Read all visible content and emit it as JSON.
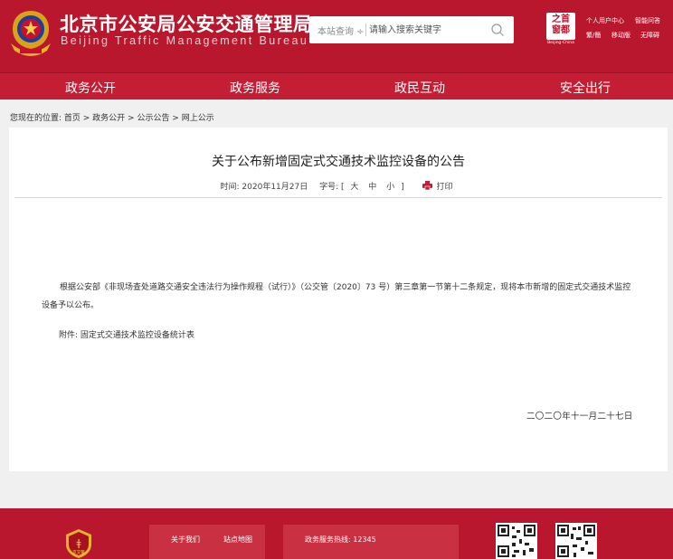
{
  "header": {
    "site_title": "北京市公安局公安交通管理局",
    "site_title_en": "Beijing Traffic Management Bureau",
    "search_scope": "本站查询 ÷",
    "search_placeholder": "请输入搜索关键字",
    "capital_logo_text": "之首 窗都",
    "capital_logo_sub": "Beijing-China",
    "top_links": [
      "个人用户中心",
      "智能问答",
      "繁/簡",
      "移动版",
      "无障碍"
    ]
  },
  "nav": {
    "items": [
      "政务公开",
      "政务服务",
      "政民互动",
      "安全出行"
    ]
  },
  "breadcrumb": {
    "prefix": "您现在的位置:",
    "path": "首页 > 政务公开 > 公示公告 > 网上公示"
  },
  "article": {
    "title": "关于公布新增固定式交通技术监控设备的公告",
    "time_label": "时间: 2020年11月27日",
    "font_label": "字号: [",
    "font_large": "大",
    "font_medium": "中",
    "font_small": "小",
    "font_close": "]",
    "print_label": "打印",
    "paragraph1": "根据公安部《非现场查处道路交通安全违法行为操作规程（试行）》（公交管〔2020〕73 号）第三章第一节第十二条规定，现将本市新增的固定式交通技术监控设备予以公布。",
    "attachment_label": "附件:",
    "attachment_link": "固定式交通技术监控设备统计表",
    "date_sign": "二〇二〇年十一月二十七日"
  },
  "footer": {
    "about": "关于我们",
    "sitemap": "站点地图",
    "hotline": "政务服务热线: 12345",
    "emblem_text": "京交警"
  },
  "colors": {
    "brand_red": "#b8172d",
    "nav_red": "#c41e34"
  }
}
